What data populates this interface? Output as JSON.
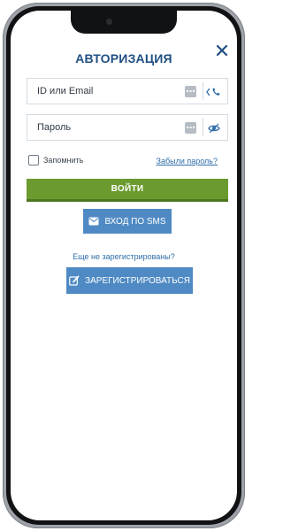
{
  "login": {
    "title": "АВТОРИЗАЦИЯ",
    "id_placeholder": "ID или Email",
    "password_placeholder": "Пароль",
    "remember_label": "Запомнить",
    "forgot_link": "Забыли пароль?",
    "submit_label": "ВОЙТИ",
    "sms_label": "ВХОД ПО SMS",
    "register_hint": "Еще не зарегистрированы?",
    "register_label": "ЗАРЕГИСТРИРОВАТЬСЯ"
  },
  "icons": {
    "close": "close-icon",
    "id_trailing": "phone-icon",
    "password_trailing": "eye-icon",
    "sms": "envelope-icon",
    "register": "edit-icon",
    "keys": "keyboard-icon"
  },
  "colors": {
    "title": "#1f4f82",
    "primary_button": "#6b9a2e",
    "secondary_button": "#4f8ac4",
    "link": "#2d6da8"
  }
}
